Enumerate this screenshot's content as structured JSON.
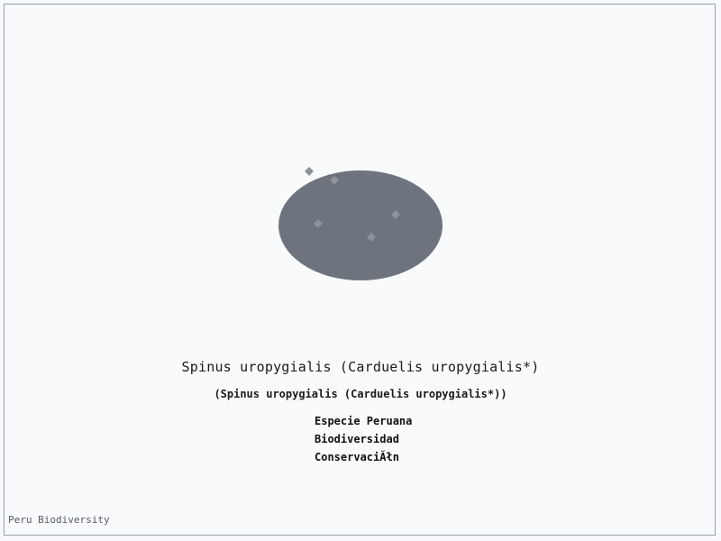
{
  "title": "Spinus uropygialis (Carduelis uropygialis*)",
  "subtitle": "(Spinus uropygialis (Carduelis uropygialis*))",
  "tags": [
    "Especie Peruana",
    "Biodiversidad",
    "ConservaciĂłn"
  ],
  "footer": "Peru Biodiversity",
  "colors": {
    "background": "#f8fafc",
    "border": "#9aa1ab",
    "ellipse": "#6e747e",
    "dots": "#8d939b"
  }
}
